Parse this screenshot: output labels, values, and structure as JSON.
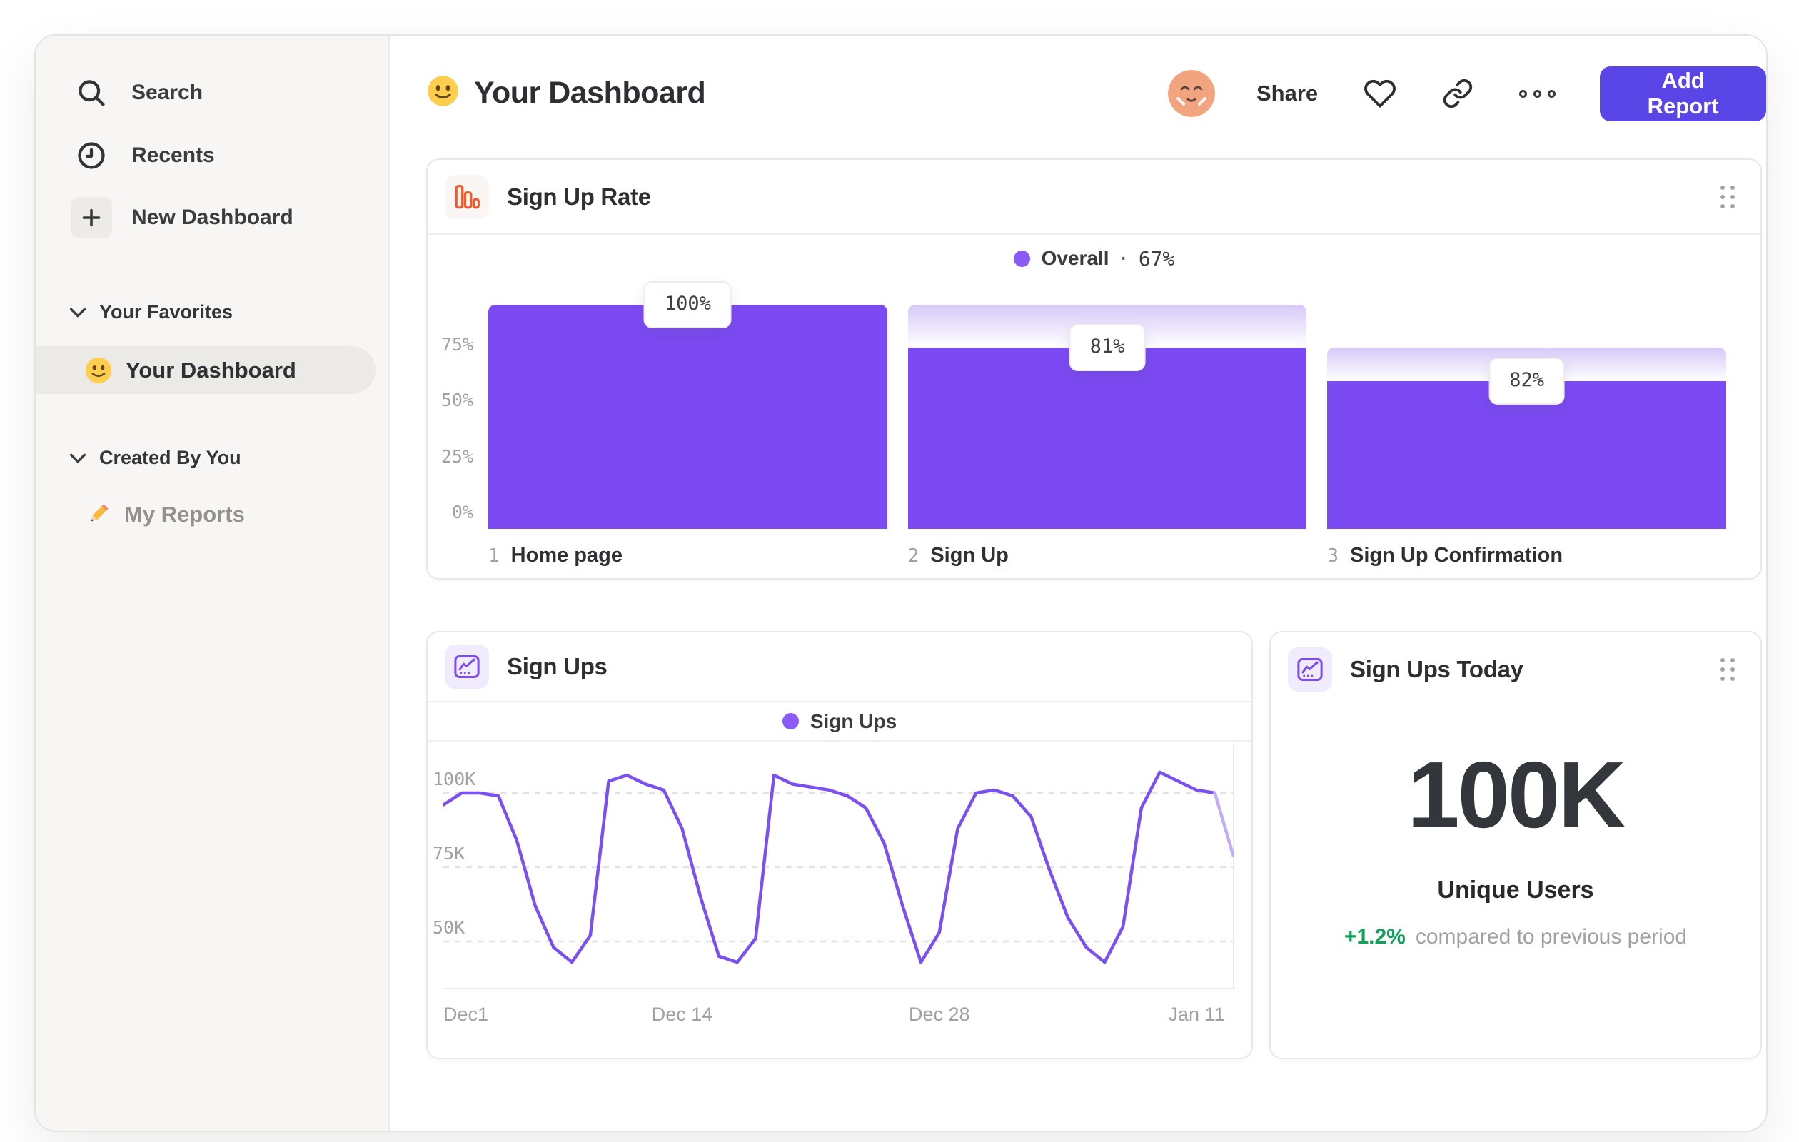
{
  "sidebar": {
    "nav": [
      {
        "label": "Search"
      },
      {
        "label": "Recents"
      },
      {
        "label": "New Dashboard"
      }
    ],
    "sections": [
      {
        "title": "Your Favorites",
        "items": [
          {
            "label": "Your Dashboard",
            "active": true
          }
        ]
      },
      {
        "title": "Created By You",
        "items": [
          {
            "label": "My Reports",
            "active": false
          }
        ]
      }
    ]
  },
  "header": {
    "title": "Your Dashboard",
    "share_label": "Share",
    "add_report_label": "Add Report"
  },
  "chart_data": [
    {
      "type": "bar",
      "variant": "funnel",
      "title": "Sign Up Rate",
      "legend": {
        "series": "Overall",
        "separator": "·",
        "value": "67%"
      },
      "ylim_pct": [
        0,
        100
      ],
      "y_ticks": [
        {
          "label": "75%",
          "pct": 75
        },
        {
          "label": "50%",
          "pct": 50
        },
        {
          "label": "25%",
          "pct": 25
        },
        {
          "label": "0%",
          "pct": 0
        }
      ],
      "steps": [
        {
          "index": "1",
          "name": "Home page",
          "overall_pct": 100,
          "prev_overall_pct": 100,
          "badge": "100%"
        },
        {
          "index": "2",
          "name": "Sign Up",
          "overall_pct": 81,
          "prev_overall_pct": 100,
          "badge": "81%"
        },
        {
          "index": "3",
          "name": "Sign Up Confirmation",
          "overall_pct": 66,
          "prev_overall_pct": 81,
          "badge": "82%"
        }
      ]
    },
    {
      "type": "line",
      "title": "Sign Ups",
      "legend": {
        "series": "Sign Ups"
      },
      "x_ticks": [
        {
          "label": "Dec1",
          "day": 0
        },
        {
          "label": "Dec 14",
          "day": 13
        },
        {
          "label": "Dec 28",
          "day": 27
        },
        {
          "label": "Jan 11",
          "day": 41
        }
      ],
      "y_ticks": [
        {
          "label": "100K",
          "value_k": 100
        },
        {
          "label": "75K",
          "value_k": 75
        },
        {
          "label": "50K",
          "value_k": 50
        }
      ],
      "ylim_k": [
        34,
        116
      ],
      "x_range_days": 43,
      "values_k": [
        96,
        100,
        100,
        99,
        84,
        62,
        48,
        43,
        52,
        104,
        106,
        103,
        101,
        88,
        65,
        45,
        43,
        51,
        106,
        103,
        102,
        101,
        99,
        95,
        83,
        62,
        43,
        53,
        88,
        100,
        101,
        99,
        92,
        74,
        58,
        48,
        43,
        55,
        95,
        107,
        104,
        101,
        100,
        79
      ],
      "incomplete_tail_segments": 1
    },
    {
      "type": "kpi",
      "title": "Sign Ups Today",
      "value": "100K",
      "label": "Unique Users",
      "delta": "+1.2%",
      "delta_note": "compared to previous period"
    }
  ],
  "colors": {
    "bar_purple": "#7c4af2",
    "bar_cap_top": "#d6c9f8",
    "line_purple": "#7b50f3",
    "line_incomplete": "#c1aef7",
    "legend_dot": "#8a5bf6",
    "funnel_icon_orange": "#ee5a30",
    "chart_icon_purple": "#7c4bf2",
    "add_report_button": "#5a45e6",
    "delta_green": "#12a15b"
  }
}
